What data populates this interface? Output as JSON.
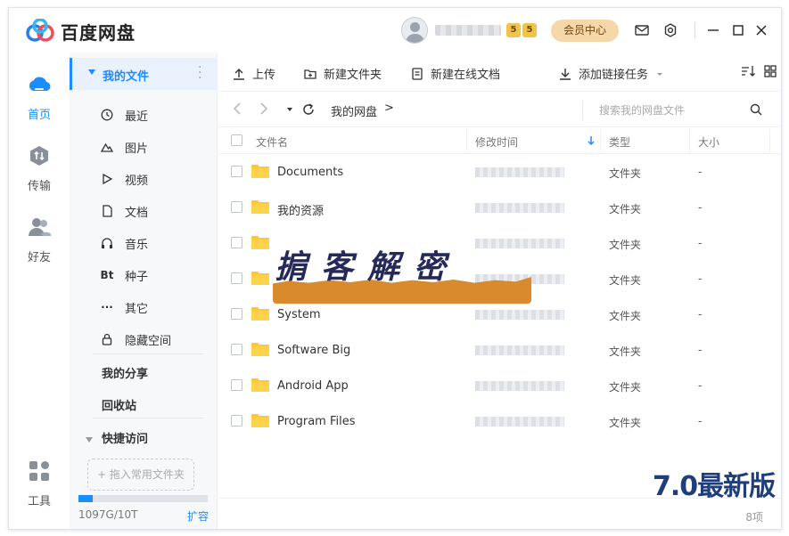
{
  "app": {
    "brand": "百度网盘",
    "vip_level_a": "5",
    "vip_level_b": "5",
    "member_center": "会员中心"
  },
  "rail": [
    {
      "label": "首页",
      "active": true
    },
    {
      "label": "传输",
      "active": false
    },
    {
      "label": "好友",
      "active": false
    },
    {
      "label": "工具",
      "active": false
    }
  ],
  "tree": {
    "root": "我的文件",
    "items": [
      "最近",
      "图片",
      "视频",
      "文档",
      "音乐",
      "种子",
      "其它",
      "隐藏空间"
    ],
    "bt_glyph": "Bt",
    "other_glyph": "···",
    "my_share": "我的分享",
    "recycle": "回收站",
    "quick_access": "快捷访问",
    "drop_hint": "+ 拖入常用文件夹",
    "quota": "1097G/10T",
    "quota_fraction": 0.107,
    "expand": "扩容"
  },
  "toolbar": {
    "upload": "上传",
    "new_folder": "新建文件夹",
    "new_doc": "新建在线文档",
    "add_link": "添加链接任务"
  },
  "path": {
    "crumb": "我的网盘",
    "sep": ">",
    "search_placeholder": "搜索我的网盘文件"
  },
  "table": {
    "headers": {
      "name": "文件名",
      "modified": "修改时间",
      "type": "类型",
      "size": "大小"
    },
    "rows": [
      {
        "name": "Documents",
        "type": "文件夹",
        "size": "-"
      },
      {
        "name": "我的资源",
        "type": "文件夹",
        "size": "-"
      },
      {
        "name": "",
        "type": "文件夹",
        "size": "-"
      },
      {
        "name": "",
        "type": "文件夹",
        "size": "-"
      },
      {
        "name": "System",
        "type": "文件夹",
        "size": "-"
      },
      {
        "name": "Software Big",
        "type": "文件夹",
        "size": "-"
      },
      {
        "name": "Android App",
        "type": "文件夹",
        "size": "-"
      },
      {
        "name": "Program Files",
        "type": "文件夹",
        "size": "-"
      }
    ]
  },
  "footer": {
    "count": "8项"
  },
  "overlay": {
    "title": "掮客解密",
    "version": "7.0最新版"
  },
  "colors": {
    "accent": "#1a8dff",
    "folder": "#ffc533",
    "member_bg": "#f6d8a8",
    "overlay_band": "#d98a2c",
    "version_text": "#1f3e7a"
  }
}
